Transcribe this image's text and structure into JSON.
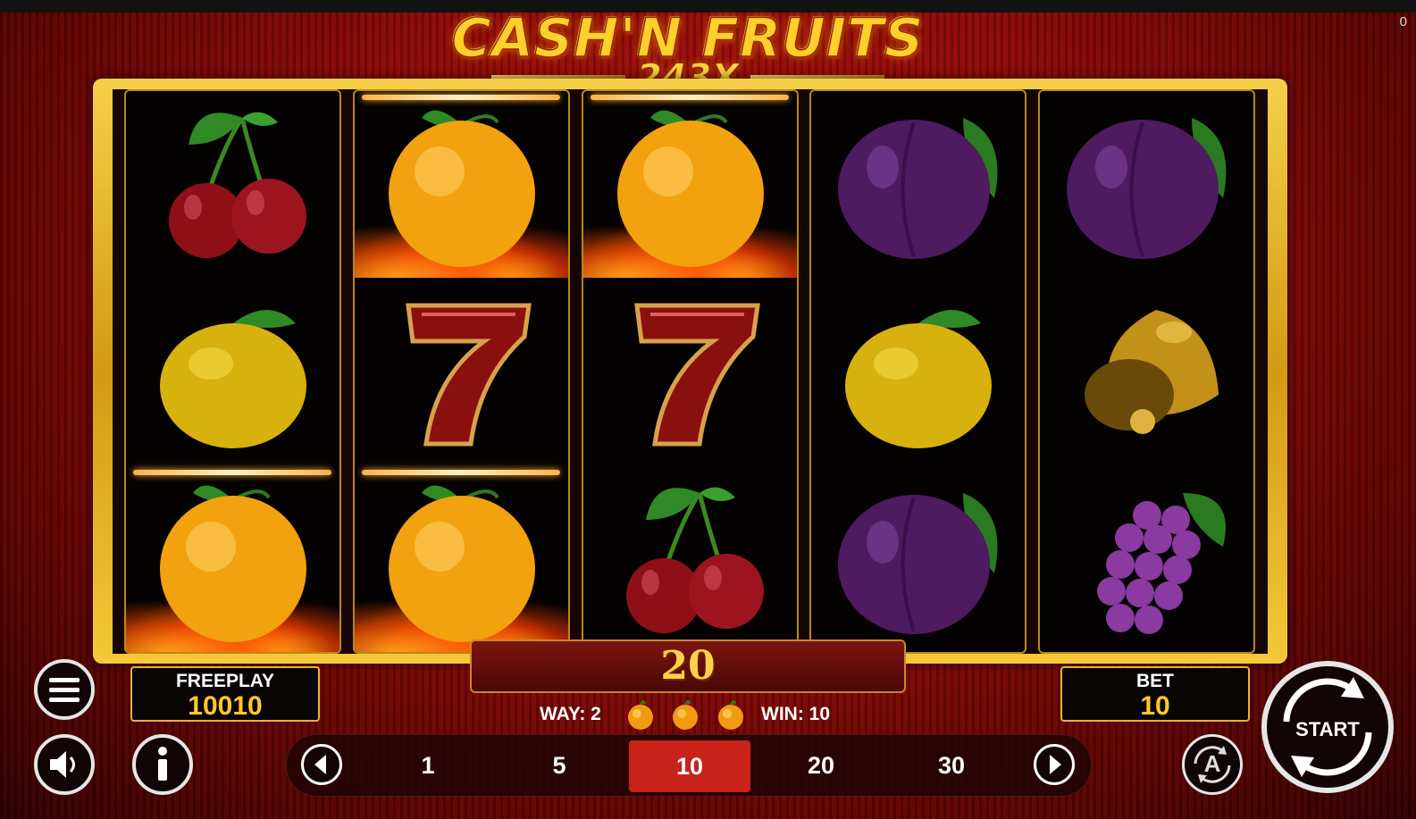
{
  "game": {
    "title_line1": "CASH'N FRUITS",
    "title_line2": "243X",
    "corner_value": "0"
  },
  "reels": [
    {
      "symbols": [
        "cherry-icon",
        "lemon-icon",
        "orange-icon"
      ],
      "burning": [
        false,
        false,
        true
      ]
    },
    {
      "symbols": [
        "orange-icon",
        "seven-icon",
        "orange-icon"
      ],
      "burning": [
        true,
        false,
        true
      ]
    },
    {
      "symbols": [
        "orange-icon",
        "seven-icon",
        "cherry-icon"
      ],
      "burning": [
        true,
        false,
        false
      ]
    },
    {
      "symbols": [
        "plum-icon",
        "lemon-icon",
        "plum-icon"
      ],
      "burning": [
        false,
        false,
        false
      ]
    },
    {
      "symbols": [
        "plum-icon",
        "bell-icon",
        "grapes-icon"
      ],
      "burning": [
        false,
        false,
        false
      ]
    }
  ],
  "win_display": {
    "amount": "20"
  },
  "way_info": {
    "way_label": "WAY: 2",
    "win_label": "WIN: 10",
    "symbol_count": 3,
    "symbol": "orange-icon"
  },
  "freeplay": {
    "label": "FREEPLAY",
    "value": "10010"
  },
  "bet": {
    "label": "BET",
    "value": "10"
  },
  "bet_options": [
    "1",
    "5",
    "10",
    "20",
    "30"
  ],
  "selected_bet": "10",
  "start_label": "START",
  "autoplay_label": "A",
  "colors": {
    "gold": "#ffc82a",
    "frame": "#e0a82a",
    "selected": "#c8221b",
    "background": "#8a0b08"
  }
}
